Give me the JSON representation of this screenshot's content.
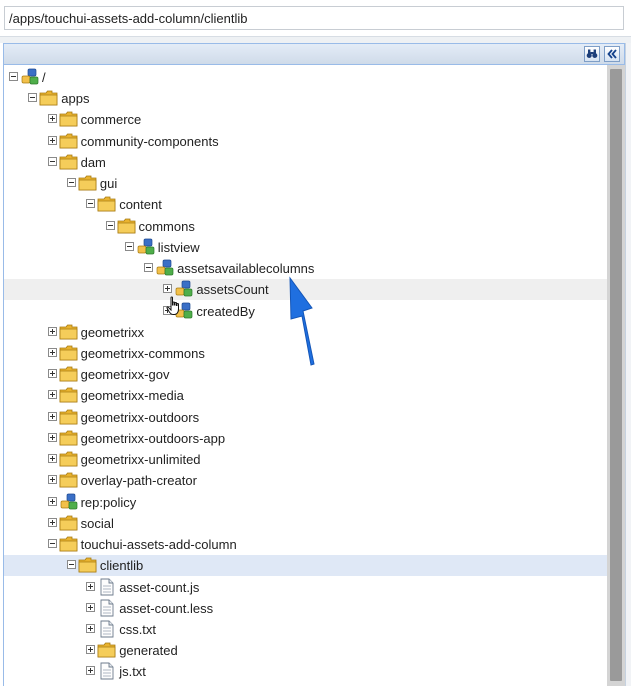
{
  "path": {
    "value": "/apps/touchui-assets-add-column/clientlib"
  },
  "toolbar": {
    "find_icon": "binoculars-icon",
    "collapse_icon": "double-chevron-left-icon"
  },
  "tree": {
    "nodes": [
      {
        "label": "/",
        "depth": 0,
        "icon": "node",
        "toggle": "minus"
      },
      {
        "label": "apps",
        "depth": 1,
        "icon": "folder",
        "toggle": "minus"
      },
      {
        "label": "commerce",
        "depth": 2,
        "icon": "folder",
        "toggle": "plus"
      },
      {
        "label": "community-components",
        "depth": 2,
        "icon": "folder",
        "toggle": "plus"
      },
      {
        "label": "dam",
        "depth": 2,
        "icon": "folder",
        "toggle": "minus"
      },
      {
        "label": "gui",
        "depth": 3,
        "icon": "folder",
        "toggle": "minus"
      },
      {
        "label": "content",
        "depth": 4,
        "icon": "folder",
        "toggle": "minus"
      },
      {
        "label": "commons",
        "depth": 5,
        "icon": "folder",
        "toggle": "minus"
      },
      {
        "label": "listview",
        "depth": 6,
        "icon": "node",
        "toggle": "minus"
      },
      {
        "label": "assetsavailablecolumns",
        "depth": 7,
        "icon": "node",
        "toggle": "minus"
      },
      {
        "label": "assetsCount",
        "depth": 8,
        "icon": "node",
        "toggle": "plus",
        "state": "hover"
      },
      {
        "label": "createdBy",
        "depth": 8,
        "icon": "node",
        "toggle": "plus"
      },
      {
        "label": "geometrixx",
        "depth": 2,
        "icon": "folder",
        "toggle": "plus"
      },
      {
        "label": "geometrixx-commons",
        "depth": 2,
        "icon": "folder",
        "toggle": "plus"
      },
      {
        "label": "geometrixx-gov",
        "depth": 2,
        "icon": "folder",
        "toggle": "plus"
      },
      {
        "label": "geometrixx-media",
        "depth": 2,
        "icon": "folder",
        "toggle": "plus"
      },
      {
        "label": "geometrixx-outdoors",
        "depth": 2,
        "icon": "folder",
        "toggle": "plus"
      },
      {
        "label": "geometrixx-outdoors-app",
        "depth": 2,
        "icon": "folder",
        "toggle": "plus"
      },
      {
        "label": "geometrixx-unlimited",
        "depth": 2,
        "icon": "folder",
        "toggle": "plus"
      },
      {
        "label": "overlay-path-creator",
        "depth": 2,
        "icon": "folder",
        "toggle": "plus"
      },
      {
        "label": "rep:policy",
        "depth": 2,
        "icon": "node",
        "toggle": "plus"
      },
      {
        "label": "social",
        "depth": 2,
        "icon": "folder",
        "toggle": "plus"
      },
      {
        "label": "touchui-assets-add-column",
        "depth": 2,
        "icon": "folder",
        "toggle": "minus"
      },
      {
        "label": "clientlib",
        "depth": 3,
        "icon": "folder",
        "toggle": "minus",
        "state": "selected"
      },
      {
        "label": "asset-count.js",
        "depth": 4,
        "icon": "file",
        "toggle": "plus"
      },
      {
        "label": "asset-count.less",
        "depth": 4,
        "icon": "file",
        "toggle": "plus"
      },
      {
        "label": "css.txt",
        "depth": 4,
        "icon": "file",
        "toggle": "plus"
      },
      {
        "label": "generated",
        "depth": 4,
        "icon": "folder",
        "toggle": "plus"
      },
      {
        "label": "js.txt",
        "depth": 4,
        "icon": "file",
        "toggle": "plus"
      }
    ]
  },
  "colors": {
    "selected_row": "#dfe8f6",
    "hover_row": "#efefef",
    "annotation_arrow": "#1f6fe0",
    "folder": "#f2c04a"
  }
}
